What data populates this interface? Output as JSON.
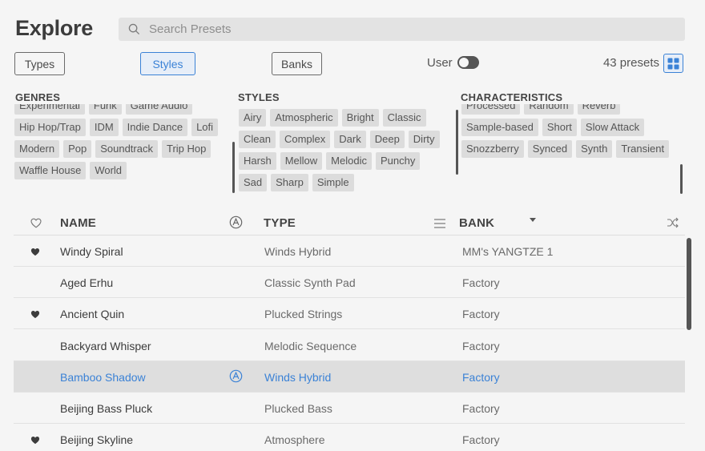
{
  "header": {
    "title": "Explore",
    "search_placeholder": "Search Presets"
  },
  "filters": {
    "types_label": "Types",
    "styles_label": "Styles",
    "banks_label": "Banks",
    "active": "Styles",
    "user_label": "User",
    "user_toggle_on": false,
    "preset_count": "43 presets"
  },
  "genres": {
    "title": "GENRES",
    "tags": [
      "Experimental",
      "Funk",
      "Game Audio",
      "Hip Hop/Trap",
      "IDM",
      "Indie Dance",
      "Lofi",
      "Modern",
      "Pop",
      "Soundtrack",
      "Trip Hop",
      "Waffle House",
      "World"
    ]
  },
  "styles": {
    "title": "STYLES",
    "tags": [
      "Airy",
      "Atmospheric",
      "Bright",
      "Classic",
      "Clean",
      "Complex",
      "Dark",
      "Deep",
      "Dirty",
      "Harsh",
      "Mellow",
      "Melodic",
      "Punchy",
      "Sad",
      "Sharp",
      "Simple"
    ]
  },
  "characteristics": {
    "title": "CHARACTERISTICS",
    "tags": [
      "Processed",
      "Random",
      "Reverb",
      "Sample-based",
      "Short",
      "Slow Attack",
      "Snozzberry",
      "Synced",
      "Synth",
      "Transient"
    ]
  },
  "table": {
    "columns": {
      "name": "NAME",
      "type": "TYPE",
      "bank": "BANK"
    },
    "rows": [
      {
        "name": "Windy Spiral",
        "type": "Winds Hybrid",
        "bank": "MM's YANGTZE 1",
        "liked": true,
        "selected": false
      },
      {
        "name": "Aged Erhu",
        "type": "Classic Synth Pad",
        "bank": "Factory",
        "liked": false,
        "selected": false
      },
      {
        "name": "Ancient Quin",
        "type": "Plucked Strings",
        "bank": "Factory",
        "liked": true,
        "selected": false
      },
      {
        "name": "Backyard Whisper",
        "type": "Melodic Sequence",
        "bank": "Factory",
        "liked": false,
        "selected": false
      },
      {
        "name": "Bamboo Shadow",
        "type": "Winds Hybrid",
        "bank": "Factory",
        "liked": false,
        "selected": true
      },
      {
        "name": "Beijing Bass Pluck",
        "type": "Plucked Bass",
        "bank": "Factory",
        "liked": false,
        "selected": false
      },
      {
        "name": "Beijing Skyline",
        "type": "Atmosphere",
        "bank": "Factory",
        "liked": true,
        "selected": false
      }
    ]
  },
  "colors": {
    "accent": "#3b82d6",
    "background": "#f5f5f5",
    "tag": "#dcdcdc",
    "selected_row": "#dedede"
  }
}
